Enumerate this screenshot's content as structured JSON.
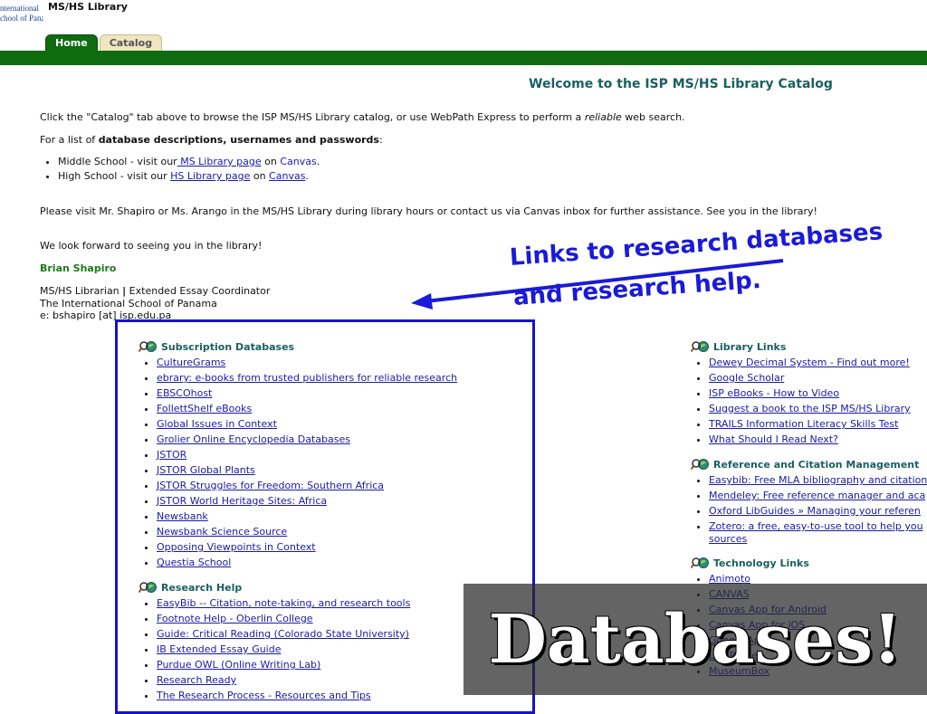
{
  "header": {
    "logo_lines": [
      "nternational",
      "chool of Panama"
    ],
    "app_title": "MS/HS Library",
    "tabs": [
      {
        "label": "Home"
      },
      {
        "label": "Catalog"
      }
    ]
  },
  "welcome": "Welcome to the ISP MS/HS Library Catalog",
  "intro": {
    "line1_a": "Click the \"Catalog\" tab above to browse the ISP MS/HS Library catalog, or use WebPath Express to perform a ",
    "line1_em": "reliable",
    "line1_b": " web search.",
    "line2_a": "For a list of ",
    "line2_b": "database descriptions, usernames and passwords",
    "line2_c": ":",
    "ms": {
      "a": "Middle School - visit our",
      "link": " MS Library page",
      "b": " on ",
      "canvas": "Canvas",
      "c": "."
    },
    "hs": {
      "a": "High School - visit our ",
      "link": "HS Library page",
      "b": " on ",
      "canvas": "Canvas",
      "c": "."
    },
    "visit": "Please visit Mr. Shapiro or Ms. Arango in the MS/HS Library during library hours or contact us via Canvas inbox for further assistance. See you in the library!",
    "forward": "We look forward to seeing you in the library!",
    "signature": "Brian Shapiro",
    "addr1_a": "MS/HS Librarian ",
    "addr1_sep": "|",
    "addr1_b": " Extended Essay Coordinator",
    "addr2": "The International School of Panama",
    "addr3": "e: bshapiro [at] isp.edu.pa"
  },
  "subscription": {
    "title": "Subscription Databases",
    "items": [
      "CultureGrams",
      "ebrary: e-books from trusted publishers for reliable research",
      "EBSCOhost",
      "FollettShelf eBooks",
      "Global Issues in Context",
      "Grolier Online Encyclopedia Databases",
      "JSTOR",
      "JSTOR Global Plants",
      "JSTOR Struggles for Freedom: Southern Africa",
      "JSTOR World Heritage Sites: Africa",
      "Newsbank",
      "Newsbank Science Source",
      "Opposing Viewpoints in Context",
      "Questia School"
    ]
  },
  "research": {
    "title": "Research Help",
    "items": [
      "EasyBib -- Citation, note-taking, and research tools",
      "Footnote Help - Oberlin College",
      "Guide: Critical Reading (Colorado State University)",
      "IB Extended Essay Guide",
      "Purdue OWL (Online Writing Lab)",
      "Research Ready",
      "The Research Process - Resources and Tips"
    ]
  },
  "library_links": {
    "title": "Library Links",
    "items": [
      "Dewey Decimal System - Find out more!",
      "Google Scholar",
      "ISP eBooks - How to Video",
      "Suggest a book to the ISP MS/HS Library",
      "TRAILS Information Literacy Skills Test",
      "What Should I Read Next?"
    ]
  },
  "reference": {
    "title": "Reference and Citation Management",
    "items": [
      "Easybib: Free MLA bibliography and citation",
      "Mendeley: Free reference manager and aca",
      "Oxford LibGuides » Managing your referen",
      "Zotero: a free, easy-to-use tool to help you"
    ],
    "item4_cont": "sources"
  },
  "technology": {
    "title": "Technology Links",
    "items": [
      "Animoto",
      "CANVAS",
      "Canvas App for Android",
      "Canvas App for iOS",
      "Google Apps",
      "LiveBinder",
      "MuseumBox"
    ]
  },
  "annotation": {
    "line1": "Links to research databases",
    "line2": "and research help."
  },
  "banner": "Databases!",
  "colors": {
    "green": "#0e6b0e",
    "link": "#1a1aa6",
    "annotation": "#1a1ad8",
    "heading": "#1b5f5f"
  }
}
